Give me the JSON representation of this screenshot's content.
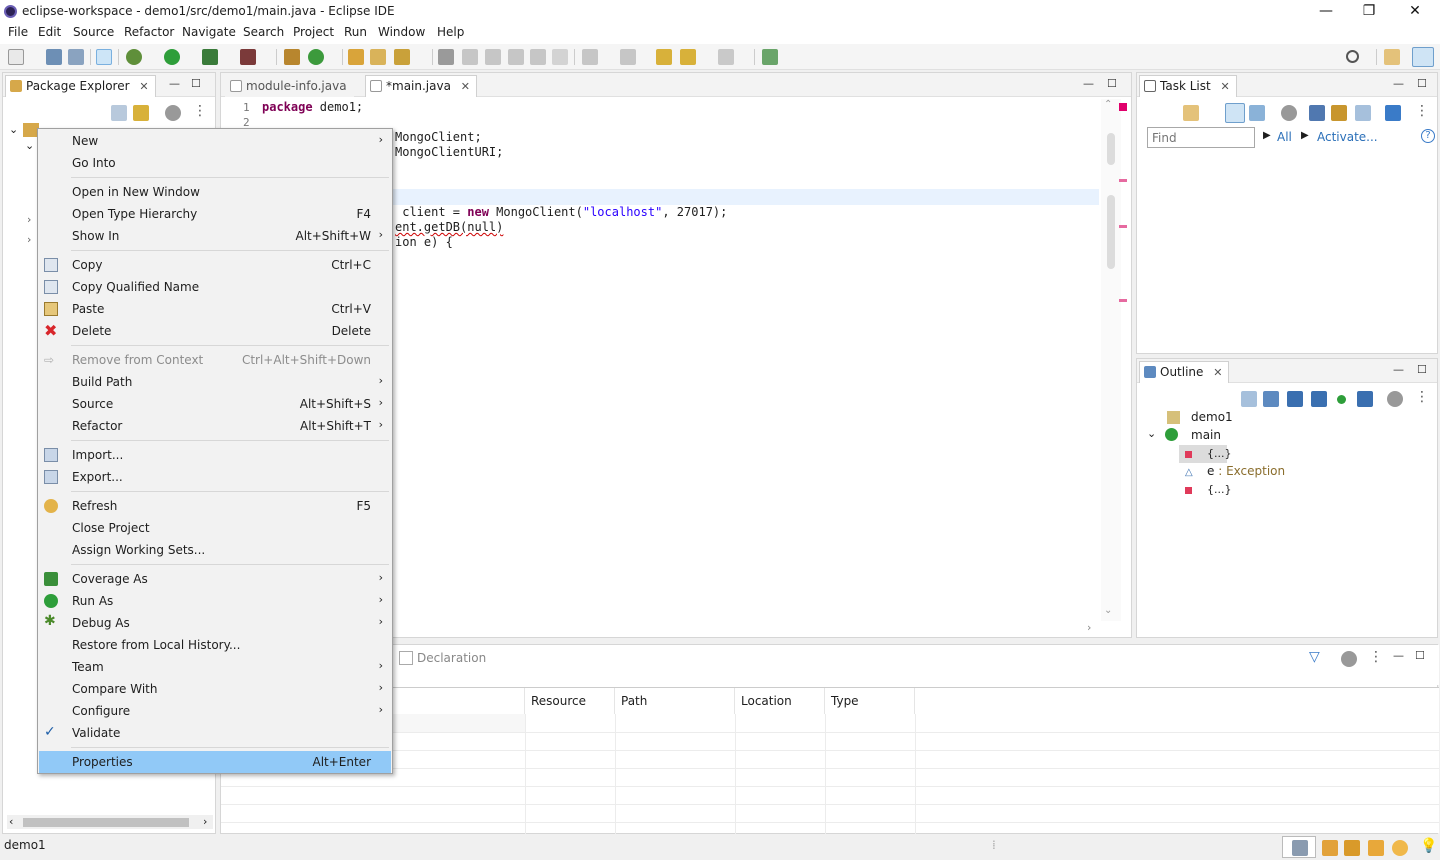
{
  "window": {
    "title": "eclipse-workspace - demo1/src/demo1/main.java - Eclipse IDE",
    "minimize": "—",
    "maximize": "❐",
    "close": "✕"
  },
  "menubar": [
    "File",
    "Edit",
    "Source",
    "Refactor",
    "Navigate",
    "Search",
    "Project",
    "Run",
    "Window",
    "Help"
  ],
  "package_explorer": {
    "tab_label": "Package Explorer",
    "close": "✕"
  },
  "editor": {
    "tabs": [
      {
        "label": "module-info.java"
      },
      {
        "label": "*main.java"
      }
    ],
    "line_numbers": [
      "1",
      "2"
    ],
    "lines": {
      "l1_kw": "package",
      "l1_rest": " demo1;",
      "l2": "MongoClient;",
      "l3": "MongoClientURI;",
      "l4_pre": " client = ",
      "l4_kw": "new",
      "l4_mid": " MongoClient(",
      "l4_str": "\"localhost\"",
      "l4_post": ", 27017);",
      "l5": "ent.getDB(null)",
      "l6": "ion e) {"
    }
  },
  "task_list": {
    "tab_label": "Task List",
    "find_placeholder": "Find",
    "all_label": "All",
    "activate_label": "Activate..."
  },
  "outline": {
    "tab_label": "Outline",
    "items": [
      {
        "label": "demo1"
      },
      {
        "label": "main"
      },
      {
        "label": "{...}"
      },
      {
        "label": "e",
        "type": " : Exception"
      },
      {
        "label": "{...}"
      }
    ]
  },
  "bottom": {
    "declaration_tab": "Declaration",
    "columns": [
      "Resource",
      "Path",
      "Location",
      "Type"
    ]
  },
  "context_menu": {
    "items": [
      {
        "label": "New",
        "accel": "",
        "submenu": true
      },
      {
        "label": "Go Into",
        "accel": ""
      },
      {
        "label": "Open in New Window",
        "accel": ""
      },
      {
        "label": "Open Type Hierarchy",
        "accel": "F4"
      },
      {
        "label": "Show In",
        "accel": "Alt+Shift+W",
        "submenu": true
      },
      {
        "label": "Copy",
        "accel": "Ctrl+C"
      },
      {
        "label": "Copy Qualified Name",
        "accel": ""
      },
      {
        "label": "Paste",
        "accel": "Ctrl+V"
      },
      {
        "label": "Delete",
        "accel": "Delete"
      },
      {
        "label": "Remove from Context",
        "accel": "Ctrl+Alt+Shift+Down"
      },
      {
        "label": "Build Path",
        "accel": "",
        "submenu": true
      },
      {
        "label": "Source",
        "accel": "Alt+Shift+S",
        "submenu": true
      },
      {
        "label": "Refactor",
        "accel": "Alt+Shift+T",
        "submenu": true
      },
      {
        "label": "Import...",
        "accel": ""
      },
      {
        "label": "Export...",
        "accel": ""
      },
      {
        "label": "Refresh",
        "accel": "F5"
      },
      {
        "label": "Close Project",
        "accel": ""
      },
      {
        "label": "Assign Working Sets...",
        "accel": ""
      },
      {
        "label": "Coverage As",
        "accel": "",
        "submenu": true
      },
      {
        "label": "Run As",
        "accel": "",
        "submenu": true
      },
      {
        "label": "Debug As",
        "accel": "",
        "submenu": true
      },
      {
        "label": "Restore from Local History...",
        "accel": ""
      },
      {
        "label": "Team",
        "accel": "",
        "submenu": true
      },
      {
        "label": "Compare With",
        "accel": "",
        "submenu": true
      },
      {
        "label": "Configure",
        "accel": "",
        "submenu": true
      },
      {
        "label": "Validate",
        "accel": ""
      },
      {
        "label": "Properties",
        "accel": "Alt+Enter"
      }
    ],
    "submenu_arrow": "›"
  },
  "statusbar": {
    "selection": "demo1"
  },
  "colors": {
    "selection": "#91c9f7",
    "keyword": "#7f0055",
    "string": "#2a00ff"
  }
}
